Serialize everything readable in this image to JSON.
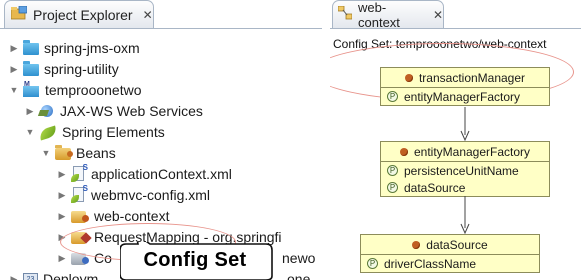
{
  "project_explorer": {
    "tab_title": "Project Explorer",
    "tree": [
      {
        "label": "spring-jms-oxm"
      },
      {
        "label": "spring-utility"
      },
      {
        "label": "temprooonetwo"
      },
      {
        "label": "JAX-WS Web Services"
      },
      {
        "label": "Spring Elements"
      },
      {
        "label": "Beans"
      },
      {
        "label": "applicationContext.xml"
      },
      {
        "label": "webmvc-config.xml"
      },
      {
        "label": "web-context"
      },
      {
        "label": "RequestMapping - org.springfi"
      },
      {
        "label": "Co"
      },
      {
        "label": "Deploym"
      }
    ],
    "partial_text_right_1": "newo",
    "partial_text_right_2": "one",
    "callout_label": "Config Set"
  },
  "web_context": {
    "tab_title": "web-context",
    "config_set_line": "Config Set: temprooonetwo/web-context",
    "beans": [
      {
        "name": "transactionManager",
        "properties": [
          "entityManagerFactory"
        ]
      },
      {
        "name": "entityManagerFactory",
        "properties": [
          "persistenceUnitName",
          "dataSource"
        ]
      },
      {
        "name": "dataSource",
        "properties": [
          "driverClassName"
        ]
      }
    ]
  },
  "colors": {
    "bean_fill": "#ffffc6",
    "highlight": "#e8948c",
    "folder_blue": "#2f91cf"
  }
}
